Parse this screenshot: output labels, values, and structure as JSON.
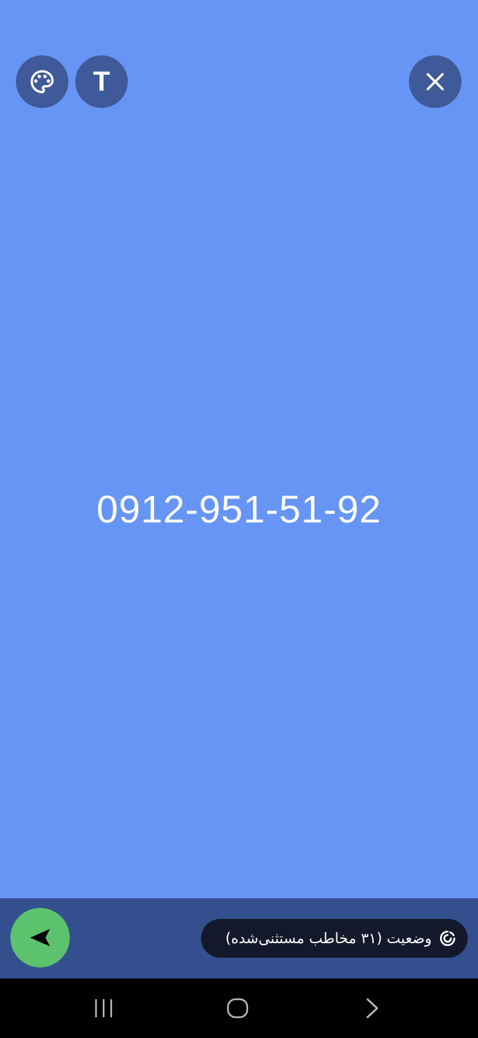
{
  "composer": {
    "background_color": "#6795f5",
    "text_color": "#ffffff",
    "status_text": "0912-951-51-92"
  },
  "toolbar": {
    "button_color": "#3f5a99",
    "palette_icon": "palette-icon",
    "text_style_icon": "text-format-icon",
    "text_style_glyph": "T",
    "close_icon": "close-icon"
  },
  "bottom_bar": {
    "background_color": "#344f8d",
    "privacy_label": "وضعیت (۳۱ مخاطب مستثنی‌شده)",
    "privacy_pill_color": "#13192a",
    "privacy_icon": "privacy-circle-icon",
    "send_button_color": "#5cc26e",
    "send_icon": "send-arrow-icon"
  },
  "system_nav": {
    "background_color": "#000000",
    "recents_icon": "recents-icon",
    "home_icon": "home-icon",
    "back_icon": "back-icon"
  }
}
